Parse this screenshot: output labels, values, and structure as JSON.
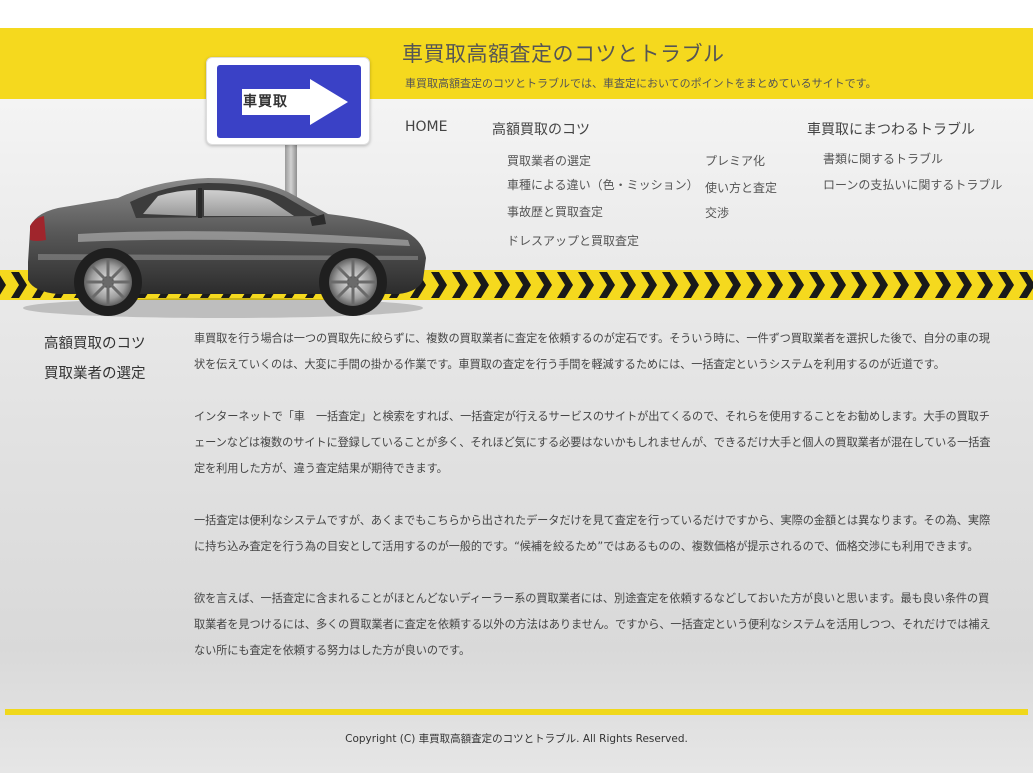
{
  "colors": {
    "accent_yellow": "#f5d91e",
    "sign_blue": "#3a41c6"
  },
  "header": {
    "title": "車買取高額査定のコツとトラブル",
    "subtitle": "車買取高額査定のコツとトラブルでは、車査定においてのポイントをまとめているサイトです。",
    "sign_text": "車買取"
  },
  "nav": {
    "home": "HOME",
    "tips": "高額買取のコツ",
    "trouble": "車買取にまつわるトラブル",
    "tips_sub_col1": [
      "買取業者の選定",
      "車種による違い（色・ミッション）",
      "事故歴と買取査定",
      "ドレスアップと買取査定"
    ],
    "tips_sub_col2": [
      "プレミア化",
      "使い方と査定",
      "交渉"
    ],
    "trouble_sub": [
      "書類に関するトラブル",
      "ローンの支払いに関するトラブル"
    ]
  },
  "sidebar": {
    "items": [
      "高額買取のコツ",
      "買取業者の選定"
    ]
  },
  "main": {
    "paragraphs": [
      "車買取を行う場合は一つの買取先に絞らずに、複数の買取業者に査定を依頼するのが定石です。そういう時に、一件ずつ買取業者を選択した後で、自分の車の現状を伝えていくのは、大変に手間の掛かる作業です。車買取の査定を行う手間を軽減するためには、一括査定というシステムを利用するのが近道です。",
      "インターネットで「車　一括査定」と検索をすれば、一括査定が行えるサービスのサイトが出てくるので、それらを使用することをお勧めします。大手の買取チェーンなどは複数のサイトに登録していることが多く、それほど気にする必要はないかもしれませんが、できるだけ大手と個人の買取業者が混在している一括査定を利用した方が、違う査定結果が期待できます。",
      "一括査定は便利なシステムですが、あくまでもこちらから出されたデータだけを見て査定を行っているだけですから、実際の金額とは異なります。その為、実際に持ち込み査定を行う為の目安として活用するのが一般的です。“候補を絞るため”ではあるものの、複数価格が提示されるので、価格交渉にも利用できます。",
      "欲を言えば、一括査定に含まれることがほとんどないディーラー系の買取業者には、別途査定を依頼するなどしておいた方が良いと思います。最も良い条件の買取業者を見つけるには、多くの買取業者に査定を依頼する以外の方法はありません。ですから、一括査定という便利なシステムを活用しつつ、それだけでは補えない所にも査定を依頼する努力はした方が良いのです。"
    ]
  },
  "footer": {
    "copyright": "Copyright (C)  車買取高額査定のコツとトラブル.  All Rights Reserved."
  }
}
